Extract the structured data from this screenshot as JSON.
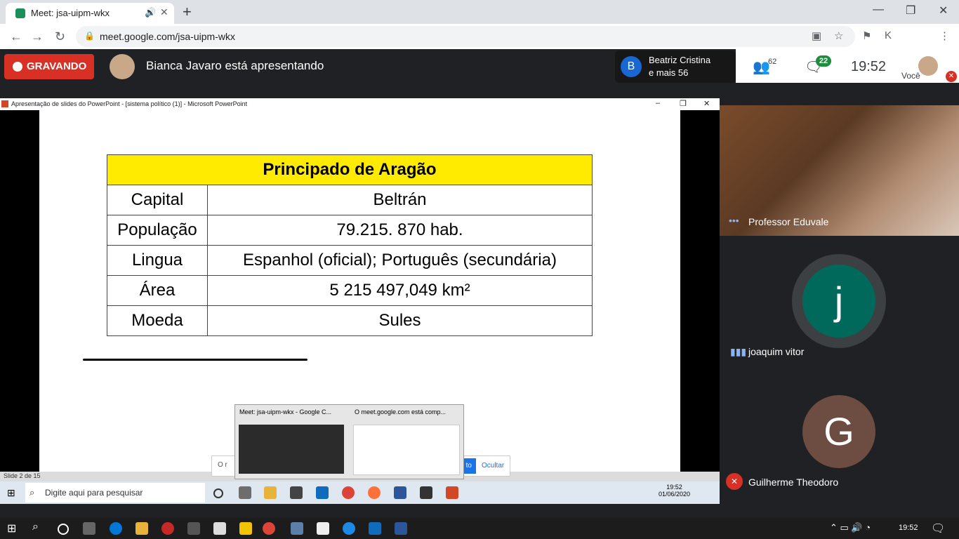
{
  "browser": {
    "tab_title": "Meet: jsa-uipm-wkx",
    "url": "meet.google.com/jsa-uipm-wkx"
  },
  "meet": {
    "recording_label": "GRAVANDO",
    "presenting_text": "Bianca Javaro está apresentando",
    "participant_chip_line1": "Beatriz Cristina",
    "participant_chip_line2": "e mais 56",
    "participant_chip_initial": "B",
    "people_count": "62",
    "chat_count": "22",
    "time": "19:52",
    "self_label": "Você"
  },
  "powerpoint": {
    "window_title": "Apresentação de slides do PowerPoint - [sistema político (1)] - Microsoft PowerPoint",
    "slide_counter": "Slide 2 de 15",
    "table": {
      "title": "Principado de Aragão",
      "rows": [
        {
          "label": "Capital",
          "value": "Beltrán"
        },
        {
          "label": "População",
          "value": "79.215. 870 hab."
        },
        {
          "label": "Lingua",
          "value": "Espanhol (oficial); Português (secundária)"
        },
        {
          "label": "Área",
          "value": "5 215 497,049 km²"
        },
        {
          "label": "Moeda",
          "value": "Sules"
        }
      ]
    }
  },
  "notice": {
    "text": "O r",
    "button": "to",
    "hide": "Ocultar"
  },
  "inner_taskbar": {
    "search_placeholder": "Digite aqui para pesquisar",
    "time": "19:52",
    "date": "01/06/2020"
  },
  "popup": {
    "item1": "Meet: jsa-uipm-wkx - Google C...",
    "item2": "O meet.google.com está comp..."
  },
  "participants": {
    "p1_name": "Professor Eduvale",
    "p2_name": "joaquim vitor",
    "p2_initial": "j",
    "p3_name": "Guilherme Theodoro",
    "p3_initial": "G"
  },
  "os": {
    "time": "19:52"
  }
}
